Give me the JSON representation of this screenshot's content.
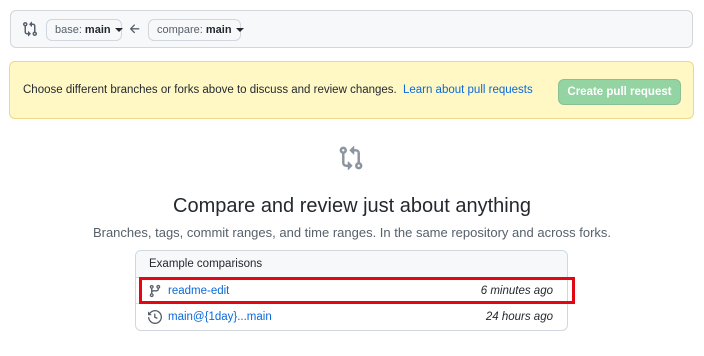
{
  "range_bar": {
    "base_label": "base:",
    "base_value": "main",
    "compare_label": "compare:",
    "compare_value": "main"
  },
  "flash": {
    "message": "Choose different branches or forks above to discuss and review changes.",
    "link": "Learn about pull requests",
    "create_button": "Create pull request"
  },
  "blankslate": {
    "title": "Compare and review just about anything",
    "subtitle": "Branches, tags, commit ranges, and time ranges. In the same repository and across forks."
  },
  "examples": {
    "header": "Example comparisons",
    "rows": [
      {
        "icon": "branch-icon",
        "label": "readme-edit",
        "time": "6 minutes ago"
      },
      {
        "icon": "history-icon",
        "label": "main@{1day}...main",
        "time": "24 hours ago"
      }
    ]
  },
  "colors": {
    "link": "#0969da",
    "create_button_disabled": "#94d3a2",
    "flash_bg": "#fff8c5",
    "highlight": "#e30613"
  }
}
